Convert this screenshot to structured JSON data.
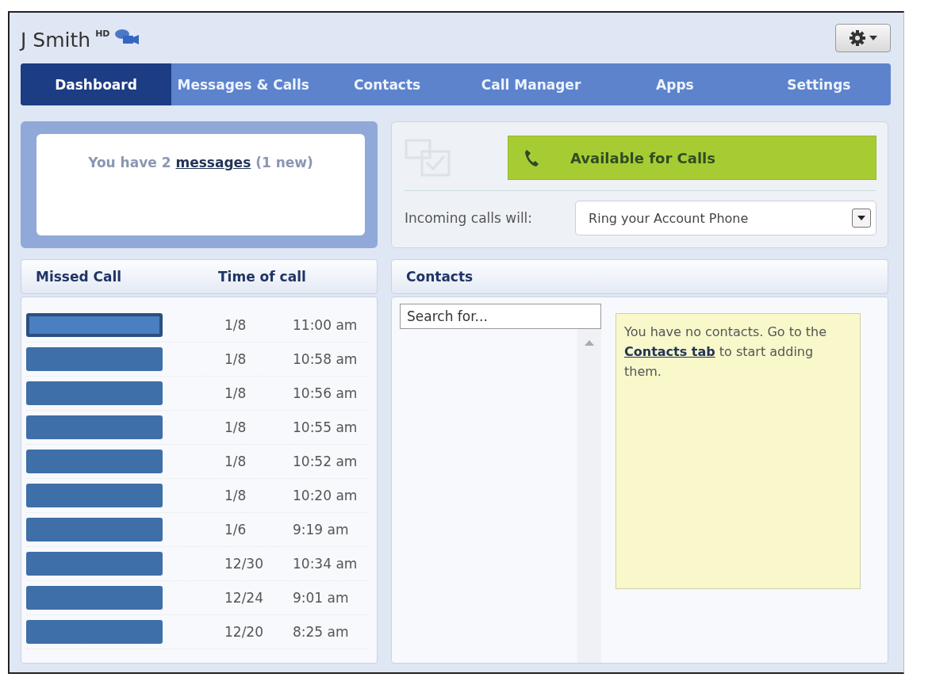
{
  "header": {
    "user_name": "J Smith",
    "badge": "HD"
  },
  "tabs": [
    {
      "label": "Dashboard",
      "selected": true
    },
    {
      "label": "Messages & Calls",
      "selected": false
    },
    {
      "label": "Contacts",
      "selected": false
    },
    {
      "label": "Call Manager",
      "selected": false
    },
    {
      "label": "Apps",
      "selected": false
    },
    {
      "label": "Settings",
      "selected": false
    }
  ],
  "messages": {
    "before": "You have 2 ",
    "link": "messages",
    "after": " (1 new)"
  },
  "availability": {
    "button": "Available for Calls",
    "incoming_label": "Incoming calls will:",
    "incoming_value": "Ring your Account Phone"
  },
  "missed_calls": {
    "columns": [
      "Missed Call",
      "Time of call"
    ],
    "rows": [
      {
        "selected": true,
        "date": "1/8",
        "time": "11:00 am"
      },
      {
        "selected": false,
        "date": "1/8",
        "time": "10:58 am"
      },
      {
        "selected": false,
        "date": "1/8",
        "time": "10:56 am"
      },
      {
        "selected": false,
        "date": "1/8",
        "time": "10:55 am"
      },
      {
        "selected": false,
        "date": "1/8",
        "time": "10:52 am"
      },
      {
        "selected": false,
        "date": "1/8",
        "time": "10:20 am"
      },
      {
        "selected": false,
        "date": "1/6",
        "time": "9:19 am"
      },
      {
        "selected": false,
        "date": "12/30",
        "time": "10:34 am"
      },
      {
        "selected": false,
        "date": "12/24",
        "time": "9:01 am"
      },
      {
        "selected": false,
        "date": "12/20",
        "time": "8:25 am"
      }
    ]
  },
  "contacts": {
    "title": "Contacts",
    "search_placeholder": "Search for...",
    "note": {
      "before": "You have no contacts. Go to the ",
      "link": "Contacts tab",
      "after": " to start adding them."
    }
  }
}
